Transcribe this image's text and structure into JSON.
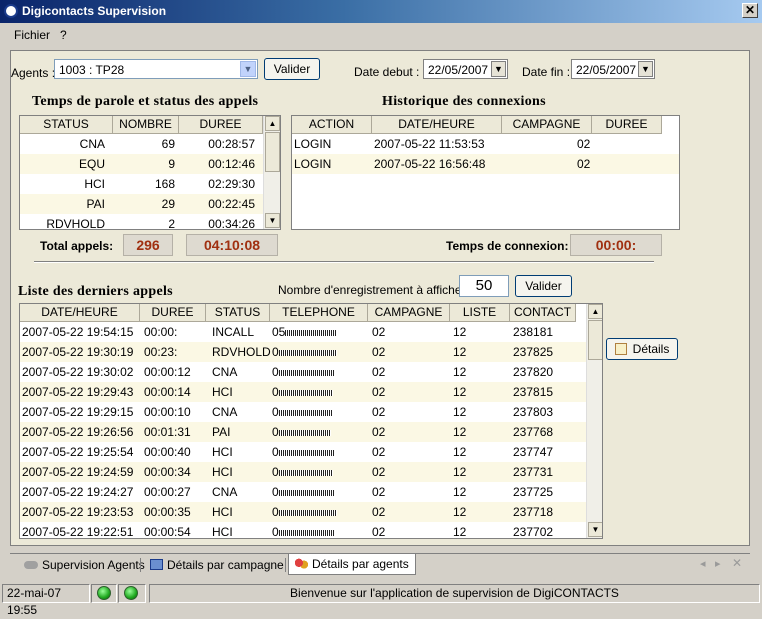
{
  "window": {
    "title": "Digicontacts Supervision"
  },
  "menu": {
    "file": "Fichier",
    "help": "?"
  },
  "filters": {
    "agents_label": "Agents :",
    "agent_value": "1003 : TP28",
    "validate": "Valider",
    "date_start_label": "Date debut :",
    "date_start": "22/05/2007",
    "date_end_label": "Date fin :",
    "date_end": "22/05/2007"
  },
  "talk_section": {
    "title": "Temps de parole et status des appels",
    "headers": [
      "STATUS",
      "NOMBRE",
      "DUREE"
    ],
    "rows": [
      [
        "CNA",
        "69",
        "00:28:57"
      ],
      [
        "EQU",
        "9",
        "00:12:46"
      ],
      [
        "HCI",
        "168",
        "02:29:30"
      ],
      [
        "PAI",
        "29",
        "00:22:45"
      ],
      [
        "RDVHOLD",
        "2",
        "00:34:26"
      ]
    ],
    "total_label": "Total appels:",
    "total_count": "296",
    "total_time": "04:10:08"
  },
  "history_section": {
    "title": "Historique des connexions",
    "headers": [
      "ACTION",
      "DATE/HEURE",
      "CAMPAGNE",
      "DUREE"
    ],
    "rows": [
      [
        "LOGIN",
        "2007-05-22 11:53:53",
        "02",
        ""
      ],
      [
        "LOGIN",
        "2007-05-22 16:56:48",
        "02",
        ""
      ]
    ],
    "conn_label": "Temps de connexion:",
    "conn_time": "00:00:"
  },
  "calls_section": {
    "title": "Liste des derniers appels",
    "count_label": "Nombre d'enregistrement à afficher:",
    "count_value": "50",
    "validate": "Valider",
    "details": "Détails",
    "headers": [
      "DATE/HEURE",
      "DUREE",
      "STATUS",
      "TELEPHONE",
      "CAMPAGNE",
      "LISTE",
      "CONTACT"
    ],
    "rows": [
      [
        "2007-05-22 19:54:15",
        "00:00:",
        "INCALL",
        "05",
        "02",
        "12",
        "238181"
      ],
      [
        "2007-05-22 19:30:19",
        "00:23:",
        "RDVHOLD",
        "0",
        "02",
        "12",
        "237825"
      ],
      [
        "2007-05-22 19:30:02",
        "00:00:12",
        "CNA",
        "0",
        "02",
        "12",
        "237820"
      ],
      [
        "2007-05-22 19:29:43",
        "00:00:14",
        "HCI",
        "0",
        "02",
        "12",
        "237815"
      ],
      [
        "2007-05-22 19:29:15",
        "00:00:10",
        "CNA",
        "0",
        "02",
        "12",
        "237803"
      ],
      [
        "2007-05-22 19:26:56",
        "00:01:31",
        "PAI",
        "0",
        "02",
        "12",
        "237768"
      ],
      [
        "2007-05-22 19:25:54",
        "00:00:40",
        "HCI",
        "0",
        "02",
        "12",
        "237747"
      ],
      [
        "2007-05-22 19:24:59",
        "00:00:34",
        "HCI",
        "0",
        "02",
        "12",
        "237731"
      ],
      [
        "2007-05-22 19:24:27",
        "00:00:27",
        "CNA",
        "0",
        "02",
        "12",
        "237725"
      ],
      [
        "2007-05-22 19:23:53",
        "00:00:35",
        "HCI",
        "0",
        "02",
        "12",
        "237718"
      ],
      [
        "2007-05-22 19:22:51",
        "00:00:54",
        "HCI",
        "0",
        "02",
        "12",
        "237702"
      ]
    ]
  },
  "tabs": [
    "Supervision Agents",
    "Détails par campagne",
    "Détails par agents"
  ],
  "statusbar": {
    "date": "22-mai-07 19:55",
    "message": "Bienvenue sur l'application de supervision de DigiCONTACTS"
  }
}
